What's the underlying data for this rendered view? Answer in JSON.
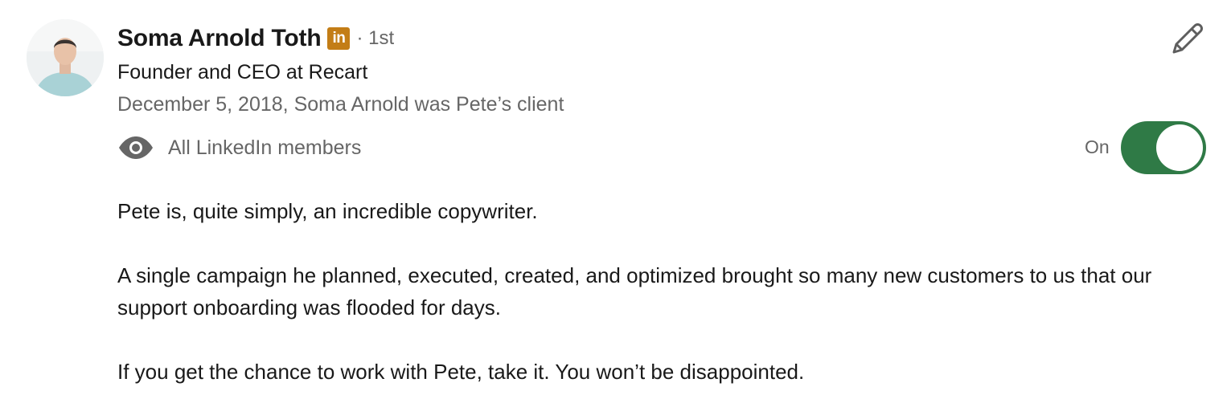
{
  "recommender": {
    "name": "Soma Arnold Toth",
    "network_badge": "in",
    "connection_degree": "· 1st",
    "headline": "Founder and CEO at Recart",
    "relationship": "December 5, 2018, Soma Arnold was Pete’s client"
  },
  "visibility": {
    "icon": "eye-icon",
    "label": "All LinkedIn members",
    "toggle_label": "On",
    "toggle_on": true
  },
  "actions": {
    "edit_icon": "pencil-icon"
  },
  "recommendation": {
    "paragraphs": [
      "Pete is, quite simply, an incredible copywriter.",
      "A single campaign he planned, executed, created, and optimized brought so many new customers to us that our support onboarding was flooded for days.",
      "If you get the chance to work with Pete, take it. You won’t be disappointed."
    ]
  },
  "colors": {
    "toggle_on": "#2f7a46",
    "badge": "#c37d16",
    "secondary_text": "#666666",
    "primary_text": "#191919"
  }
}
